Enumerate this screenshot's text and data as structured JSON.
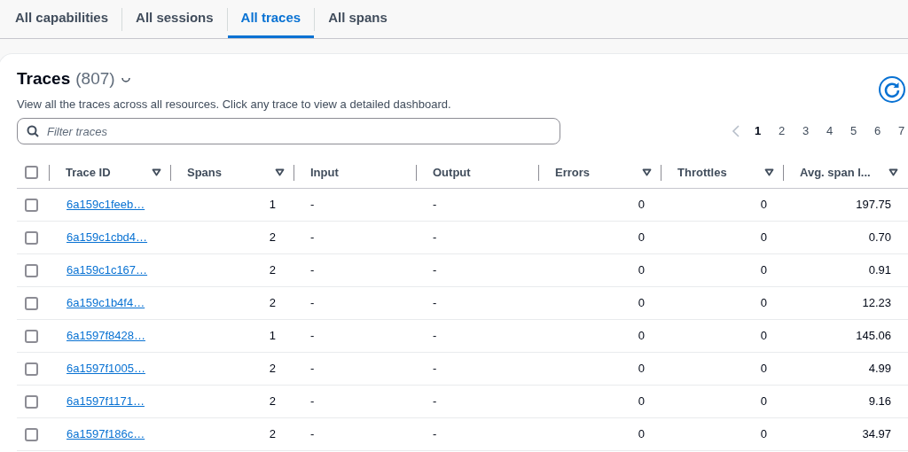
{
  "tabs": [
    {
      "label": "All capabilities",
      "selected": false
    },
    {
      "label": "All sessions",
      "selected": false
    },
    {
      "label": "All traces",
      "selected": true
    },
    {
      "label": "All spans",
      "selected": false
    }
  ],
  "panel": {
    "title": "Traces",
    "count": "(807)",
    "description": "View all the traces across all resources. Click any trace to view a detailed dashboard."
  },
  "search": {
    "placeholder": "Filter traces"
  },
  "pagination": [
    {
      "label": "1",
      "selected": true
    },
    {
      "label": "2",
      "selected": false
    },
    {
      "label": "3",
      "selected": false
    },
    {
      "label": "4",
      "selected": false
    },
    {
      "label": "5",
      "selected": false
    },
    {
      "label": "6",
      "selected": false
    },
    {
      "label": "7",
      "selected": false
    }
  ],
  "table": {
    "all_selected": false,
    "columns": [
      {
        "label": "Trace ID",
        "sortable": true
      },
      {
        "label": "Spans",
        "sortable": true
      },
      {
        "label": "Input",
        "sortable": false
      },
      {
        "label": "Output",
        "sortable": false
      },
      {
        "label": "Errors",
        "sortable": true
      },
      {
        "label": "Throttles",
        "sortable": true
      },
      {
        "label": "Avg. span l...",
        "sortable": true
      }
    ],
    "rows": [
      {
        "trace_id": "6a159c1feeb…",
        "spans": "1",
        "input": "-",
        "output": "-",
        "errors": "0",
        "throttles": "0",
        "avg_span": "197.75",
        "selected": false
      },
      {
        "trace_id": "6a159c1cbd4…",
        "spans": "2",
        "input": "-",
        "output": "-",
        "errors": "0",
        "throttles": "0",
        "avg_span": "0.70",
        "selected": false
      },
      {
        "trace_id": "6a159c1c167…",
        "spans": "2",
        "input": "-",
        "output": "-",
        "errors": "0",
        "throttles": "0",
        "avg_span": "0.91",
        "selected": false
      },
      {
        "trace_id": "6a159c1b4f4…",
        "spans": "2",
        "input": "-",
        "output": "-",
        "errors": "0",
        "throttles": "0",
        "avg_span": "12.23",
        "selected": false
      },
      {
        "trace_id": "6a1597f8428…",
        "spans": "1",
        "input": "-",
        "output": "-",
        "errors": "0",
        "throttles": "0",
        "avg_span": "145.06",
        "selected": false
      },
      {
        "trace_id": "6a1597f1005…",
        "spans": "2",
        "input": "-",
        "output": "-",
        "errors": "0",
        "throttles": "0",
        "avg_span": "4.99",
        "selected": false
      },
      {
        "trace_id": "6a1597f1171…",
        "spans": "2",
        "input": "-",
        "output": "-",
        "errors": "0",
        "throttles": "0",
        "avg_span": "9.16",
        "selected": false
      },
      {
        "trace_id": "6a1597f186c…",
        "spans": "2",
        "input": "-",
        "output": "-",
        "errors": "0",
        "throttles": "0",
        "avg_span": "34.97",
        "selected": false
      }
    ]
  }
}
